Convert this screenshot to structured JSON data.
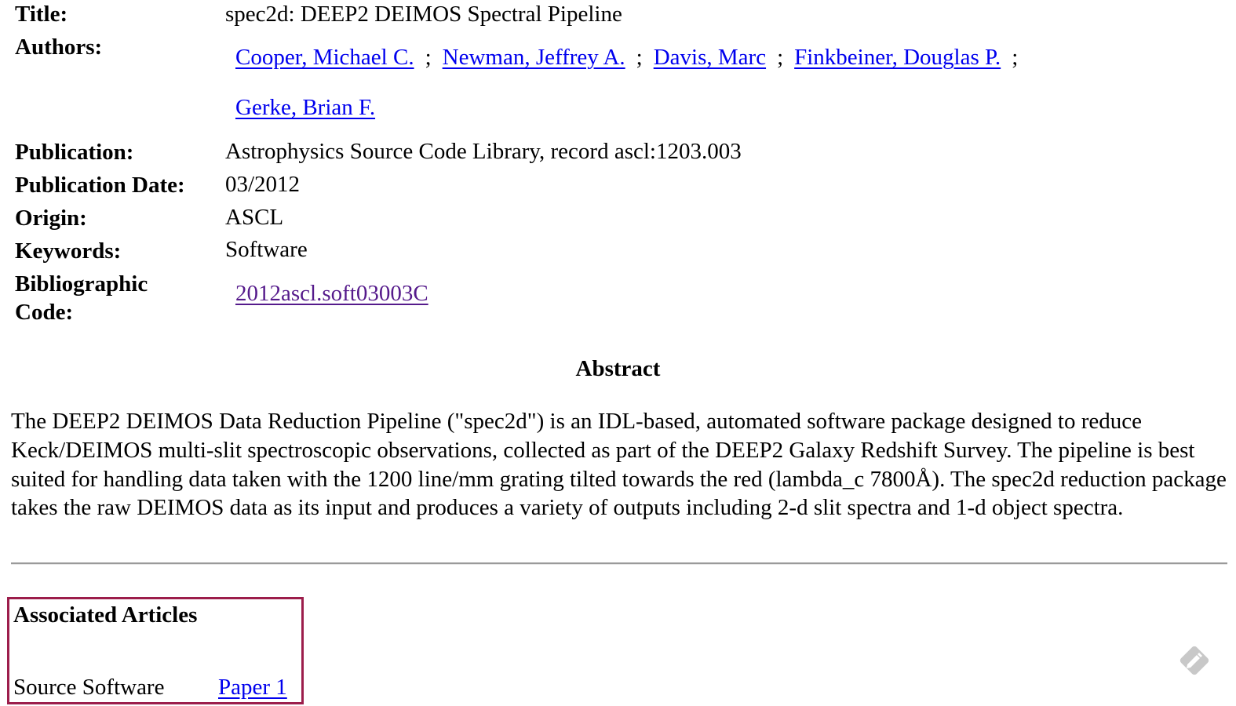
{
  "metadata": {
    "title_label": "Title:",
    "title_value": "spec2d: DEEP2 DEIMOS Spectral Pipeline",
    "authors_label": "Authors:",
    "authors": [
      {
        "name": "Cooper, Michael C."
      },
      {
        "name": "Newman, Jeffrey A."
      },
      {
        "name": "Davis, Marc"
      },
      {
        "name": "Finkbeiner, Douglas P."
      },
      {
        "name": "Gerke, Brian F."
      }
    ],
    "author_separator": ";",
    "publication_label": "Publication:",
    "publication_value": "Astrophysics Source Code Library, record ascl:1203.003",
    "pubdate_label": "Publication Date:",
    "pubdate_value": "03/2012",
    "origin_label": "Origin:",
    "origin_value": "ASCL",
    "keywords_label": "Keywords:",
    "keywords_value": "Software",
    "bibcode_label_line1": "Bibliographic",
    "bibcode_label_line2": "Code:",
    "bibcode_value": "2012ascl.soft03003C"
  },
  "abstract": {
    "heading": "Abstract",
    "text": "The DEEP2 DEIMOS Data Reduction Pipeline (\"spec2d\") is an IDL-based, automated software package designed to reduce Keck/DEIMOS multi-slit spectroscopic observations, collected as part of the DEEP2 Galaxy Redshift Survey. The pipeline is best suited for handling data taken with the 1200 line/mm grating tilted towards the red (lambda_c 7800Å). The spec2d reduction package takes the raw DEIMOS data as its input and produces a variety of outputs including 2-d slit spectra and 1-d object spectra."
  },
  "associated_articles": {
    "heading": "Associated Articles",
    "items": [
      {
        "type": "Source Software",
        "link_label": "Paper 1"
      }
    ]
  },
  "icons": {
    "corner": "pencil-edit-icon"
  },
  "colors": {
    "link": "#0000ee",
    "visited_link": "#551a8b",
    "highlight_border": "#9c1d4b"
  }
}
